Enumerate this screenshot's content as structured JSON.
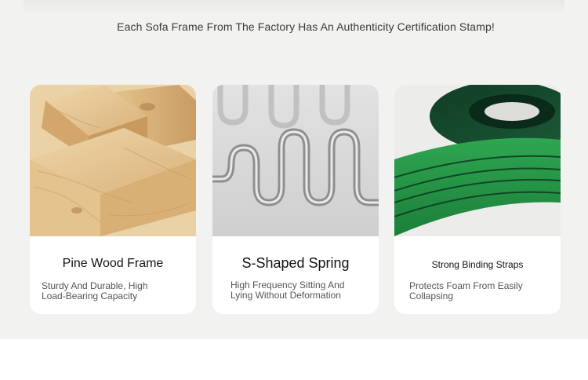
{
  "headline": "Each Sofa Frame From The Factory Has An Authenticity Certification Stamp!",
  "cards": [
    {
      "title": "Pine Wood Frame",
      "desc_line1": "Sturdy And Durable, High",
      "desc_line2": "Load-Bearing Capacity",
      "icon": "pine-wood-image"
    },
    {
      "title": "S-Shaped Spring",
      "desc_line1": "High Frequency Sitting And",
      "desc_line2": "Lying Without Deformation",
      "icon": "s-spring-image"
    },
    {
      "title": "Strong Binding Straps",
      "desc_line1": "Protects Foam From Easily",
      "desc_line2": "Collapsing",
      "icon": "green-strap-image"
    }
  ],
  "colors": {
    "section_bg": "#f2f2f1",
    "card_bg": "#ffffff",
    "strap_green": "#1f8a3e",
    "wood": "#e2c08e"
  }
}
